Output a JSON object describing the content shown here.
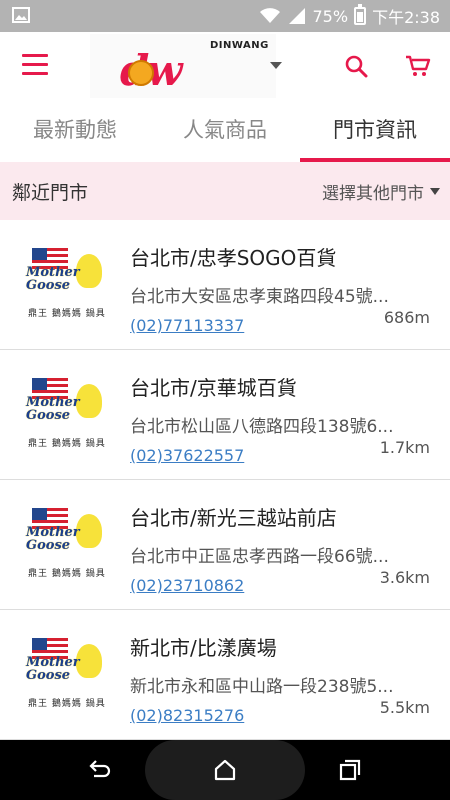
{
  "status_bar": {
    "battery": "75%",
    "time": "下午2:38"
  },
  "header": {
    "logo_brand": "DINWANG",
    "logo_text": "dw"
  },
  "tabs": [
    {
      "label": "最新動態",
      "active": false
    },
    {
      "label": "人氣商品",
      "active": false
    },
    {
      "label": "門市資訊",
      "active": true
    }
  ],
  "nearby": {
    "title": "鄰近門市",
    "select_other": "選擇其他門市"
  },
  "store_logo": {
    "brand_line1": "Mother",
    "brand_line2": "Goose",
    "subtitle": "鼎王 鵝媽媽 鍋具"
  },
  "stores": [
    {
      "name": "台北市/忠孝SOGO百貨",
      "address": "台北市大安區忠孝東路四段45號...",
      "phone": "(02)77113337",
      "distance": "686m"
    },
    {
      "name": "台北市/京華城百貨",
      "address": "台北市松山區八德路四段138號6...",
      "phone": "(02)37622557",
      "distance": "1.7km"
    },
    {
      "name": "台北市/新光三越站前店",
      "address": "台北市中正區忠孝西路一段66號...",
      "phone": "(02)23710862",
      "distance": "3.6km"
    },
    {
      "name": "新北市/比漾廣場",
      "address": "新北市永和區中山路一段238號5...",
      "phone": "(02)82315276",
      "distance": "5.5km"
    }
  ],
  "colors": {
    "accent": "#e6194b",
    "link": "#3b7dc4",
    "nearby_bg": "#fbe9ee"
  }
}
